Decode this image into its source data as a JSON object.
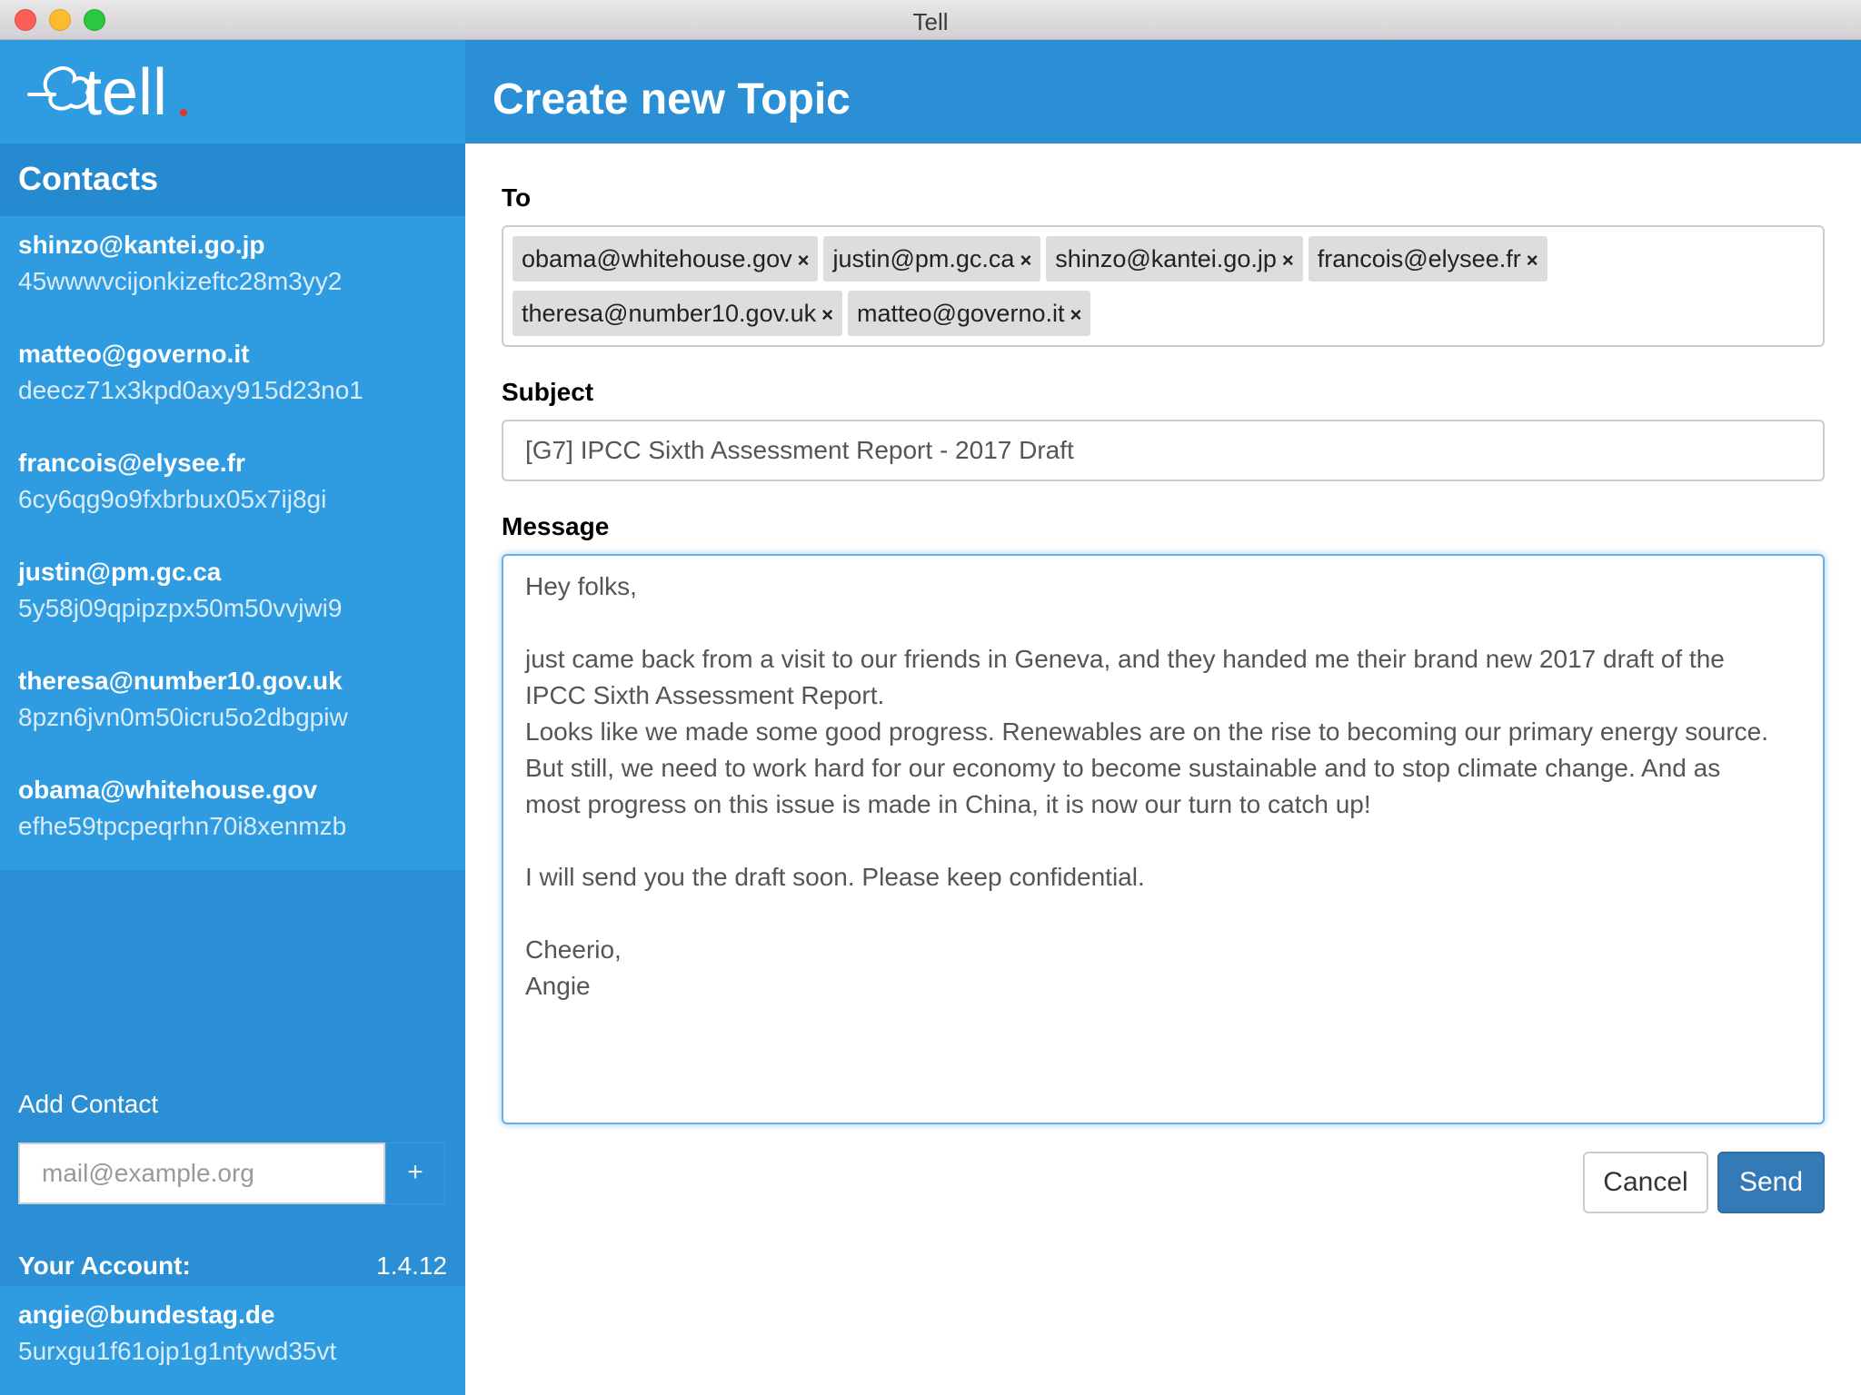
{
  "window": {
    "title": "Tell"
  },
  "sidebar": {
    "logo_text": "tell",
    "contacts_heading": "Contacts",
    "contacts": [
      {
        "email": "shinzo@kantei.go.jp",
        "key": "45wwwvcijonkizeftc28m3yy2"
      },
      {
        "email": "matteo@governo.it",
        "key": "deecz71x3kpd0axy915d23no1"
      },
      {
        "email": "francois@elysee.fr",
        "key": "6cy6qg9o9fxbrbux05x7ij8gi"
      },
      {
        "email": "justin@pm.gc.ca",
        "key": "5y58j09qpipzpx50m50vvjwi9"
      },
      {
        "email": "theresa@number10.gov.uk",
        "key": "8pzn6jvn0m50icru5o2dbgpiw"
      },
      {
        "email": "obama@whitehouse.gov",
        "key": "efhe59tpcpeqrhn70i8xenmzb"
      }
    ],
    "add_contact": {
      "label": "Add Contact",
      "placeholder": "mail@example.org",
      "button": "+"
    },
    "account": {
      "label": "Your Account:",
      "version": "1.4.12",
      "email": "angie@bundestag.de",
      "key": "5urxgu1f61ojp1g1ntywd35vt"
    }
  },
  "main": {
    "title": "Create new Topic",
    "to_label": "To",
    "recipients": [
      "obama@whitehouse.gov",
      "justin@pm.gc.ca",
      "shinzo@kantei.go.jp",
      "francois@elysee.fr",
      "theresa@number10.gov.uk",
      "matteo@governo.it"
    ],
    "remove_glyph": "×",
    "subject_label": "Subject",
    "subject_value": "[G7] IPCC Sixth Assessment Report - 2017 Draft",
    "message_label": "Message",
    "message_lines": [
      "Hey folks,",
      "",
      "just came back from a visit to our friends in Geneva, and they handed me their brand new 2017 draft of the",
      "IPCC Sixth Assessment Report.",
      "Looks like we made some good progress. Renewables are on the rise to becoming our primary energy source.",
      "But still, we need to work hard for our economy to become sustainable and to stop climate change. And as",
      "most progress on this issue is made in China, it is now our turn to catch up!",
      "",
      "I will send you the draft soon. Please keep confidential.",
      "",
      "Cheerio,",
      "Angie"
    ],
    "cancel_label": "Cancel",
    "send_label": "Send"
  },
  "colors": {
    "accent": "#2a8fd4",
    "sidebar_light": "#2f9be0",
    "send_button": "#337ab7",
    "logo_dot": "#e0352b"
  }
}
